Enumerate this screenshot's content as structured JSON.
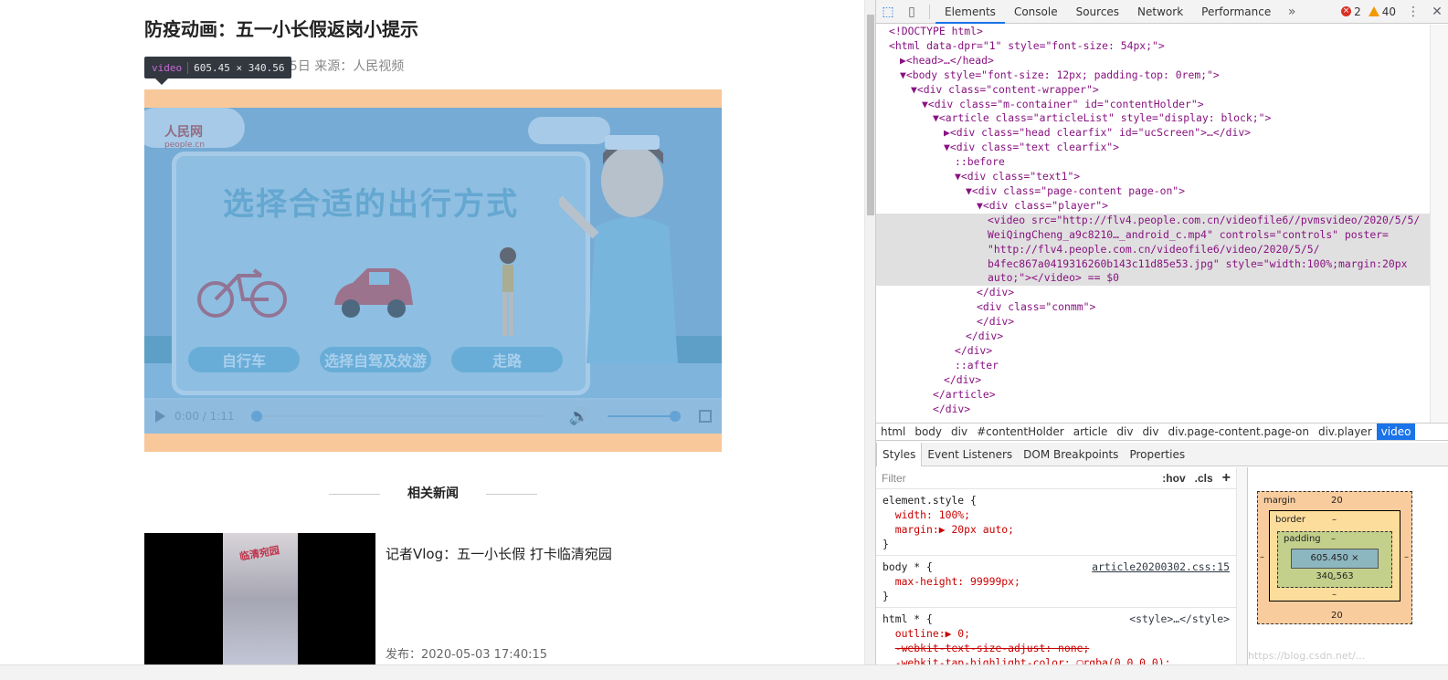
{
  "page": {
    "title": "防疫动画：五一小长假返岗小提示",
    "meta": "05日 来源：人民视频",
    "tooltip_tag": "video",
    "tooltip_size": "605.45 × 340.56",
    "video": {
      "logo": "人民网",
      "logo_sub": "people.cn",
      "board_title": "选择合适的出行方式",
      "options": [
        "自行车",
        "选择自驾及效游",
        "走路"
      ],
      "time": "0:00 / 1:11"
    },
    "related_title": "相关新闻",
    "news": [
      {
        "title": "记者Vlog：五一小长假 打卡临清宛园",
        "date": "发布：2020-05-03 17:40:15",
        "thumb_caption": "临清宛园"
      }
    ]
  },
  "devtools": {
    "tabs": [
      "Elements",
      "Console",
      "Sources",
      "Network",
      "Performance"
    ],
    "active_tab": "Elements",
    "errors": "2",
    "warnings": "40",
    "dom_lines": [
      {
        "indent": 0,
        "text": "<!DOCTYPE html>",
        "kind": "doctype"
      },
      {
        "indent": 0,
        "text": "<html data-dpr=\"1\" style=\"font-size: 54px;\">"
      },
      {
        "indent": 1,
        "text": "▶<head>…</head>"
      },
      {
        "indent": 1,
        "text": "▼<body style=\"font-size: 12px; padding-top: 0rem;\">"
      },
      {
        "indent": 2,
        "text": "▼<div class=\"content-wrapper\">"
      },
      {
        "indent": 3,
        "text": "▼<div class=\"m-container\" id=\"contentHolder\">"
      },
      {
        "indent": 4,
        "text": "▼<article class=\"articleList\" style=\"display: block;\">"
      },
      {
        "indent": 5,
        "text": "▶<div class=\"head clearfix\" id=\"ucScreen\">…</div>"
      },
      {
        "indent": 5,
        "text": "▼<div class=\"text clearfix\">"
      },
      {
        "indent": 6,
        "text": "::before"
      },
      {
        "indent": 6,
        "text": "▼<div class=\"text1\">"
      },
      {
        "indent": 7,
        "text": "▼<div class=\"page-content page-on\">"
      },
      {
        "indent": 8,
        "text": "▼<div class=\"player\">"
      },
      {
        "indent": 9,
        "text": "<video src=\"http://flv4.people.com.cn/videofile6//pvmsvideo/2020/5/5/",
        "sel": true
      },
      {
        "indent": 9,
        "text": "WeiQingCheng_a9c8210…_android_c.mp4\" controls=\"controls\" poster=",
        "sel": true
      },
      {
        "indent": 9,
        "text": "\"http://flv4.people.com.cn/videofile6/video/2020/5/5/",
        "sel": true
      },
      {
        "indent": 9,
        "text": "b4fec867a0419316260b143c11d85e53.jpg\" style=\"width:100%;margin:20px",
        "sel": true
      },
      {
        "indent": 9,
        "text": "auto;\"></video> == $0",
        "sel": true
      },
      {
        "indent": 8,
        "text": "</div>"
      },
      {
        "indent": 8,
        "text": "<div class=\"conmm\">"
      },
      {
        "indent": 8,
        "text": ""
      },
      {
        "indent": 8,
        "text": "</div>"
      },
      {
        "indent": 7,
        "text": "</div>"
      },
      {
        "indent": 6,
        "text": "</div>"
      },
      {
        "indent": 6,
        "text": "::after"
      },
      {
        "indent": 5,
        "text": "</div>"
      },
      {
        "indent": 4,
        "text": "</article>"
      },
      {
        "indent": 4,
        "text": "</div>"
      }
    ],
    "breadcrumbs": [
      "html",
      "body",
      "div",
      "#contentHolder",
      "article",
      "div",
      "div",
      "div.page-content.page-on",
      "div.player",
      "video"
    ],
    "subtabs": [
      "Styles",
      "Event Listeners",
      "DOM Breakpoints",
      "Properties"
    ],
    "filter_placeholder": "Filter",
    "hov": ":hov",
    "cls": ".cls",
    "rules": [
      {
        "selector": "element.style {",
        "props": [
          "width: 100%;",
          "margin:▶ 20px auto;"
        ],
        "source": ""
      },
      {
        "selector": "body * {",
        "props": [
          "max-height: 99999px;"
        ],
        "source": "article20200302.css:15"
      },
      {
        "selector": "html * {",
        "props": [
          "outline:▶ 0;",
          "-webkit-text-size-adjust: none;",
          "-webkit-tap-highlight-color: ▢rgba(0,0,0,0);"
        ],
        "source": "<style>…</style>"
      }
    ],
    "boxmodel": {
      "margin_label": "margin",
      "margin_top": "20",
      "margin_bottom": "20",
      "border_label": "border",
      "border_val": "–",
      "padding_label": "padding",
      "padding_val": "–",
      "content": "605.450 × 340.563",
      "side": "–"
    },
    "watermark": "https://blog.csdn.net/..."
  }
}
